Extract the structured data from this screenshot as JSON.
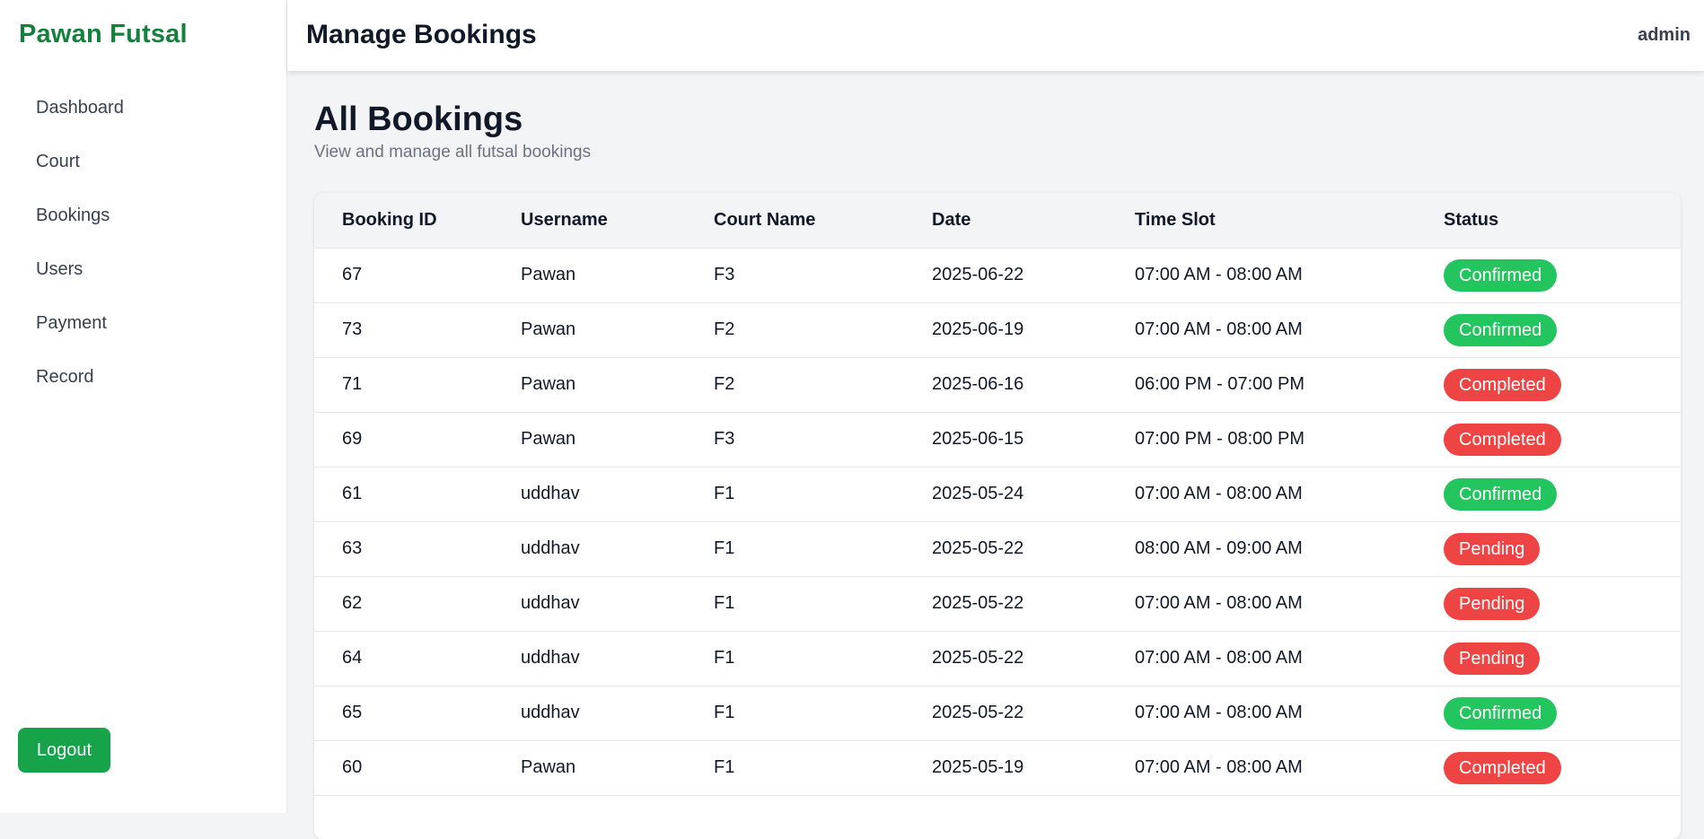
{
  "sidebar": {
    "brand": "Pawan Futsal",
    "items": [
      {
        "label": "Dashboard"
      },
      {
        "label": "Court"
      },
      {
        "label": "Bookings"
      },
      {
        "label": "Users"
      },
      {
        "label": "Payment"
      },
      {
        "label": "Record"
      }
    ],
    "logout_label": "Logout"
  },
  "topbar": {
    "title": "Manage Bookings",
    "user": "admin"
  },
  "main": {
    "title": "All Bookings",
    "subtitle": "View and manage all futsal bookings"
  },
  "table": {
    "headers": [
      "Booking ID",
      "Username",
      "Court Name",
      "Date",
      "Time Slot",
      "Status"
    ],
    "rows": [
      {
        "id": "67",
        "username": "Pawan",
        "court": "F3",
        "date": "2025-06-22",
        "slot": "07:00 AM - 08:00 AM",
        "status": "Confirmed"
      },
      {
        "id": "73",
        "username": "Pawan",
        "court": "F2",
        "date": "2025-06-19",
        "slot": "07:00 AM - 08:00 AM",
        "status": "Confirmed"
      },
      {
        "id": "71",
        "username": "Pawan",
        "court": "F2",
        "date": "2025-06-16",
        "slot": "06:00 PM - 07:00 PM",
        "status": "Completed"
      },
      {
        "id": "69",
        "username": "Pawan",
        "court": "F3",
        "date": "2025-06-15",
        "slot": "07:00 PM - 08:00 PM",
        "status": "Completed"
      },
      {
        "id": "61",
        "username": "uddhav",
        "court": "F1",
        "date": "2025-05-24",
        "slot": "07:00 AM - 08:00 AM",
        "status": "Confirmed"
      },
      {
        "id": "63",
        "username": "uddhav",
        "court": "F1",
        "date": "2025-05-22",
        "slot": "08:00 AM - 09:00 AM",
        "status": "Pending"
      },
      {
        "id": "62",
        "username": "uddhav",
        "court": "F1",
        "date": "2025-05-22",
        "slot": "07:00 AM - 08:00 AM",
        "status": "Pending"
      },
      {
        "id": "64",
        "username": "uddhav",
        "court": "F1",
        "date": "2025-05-22",
        "slot": "07:00 AM - 08:00 AM",
        "status": "Pending"
      },
      {
        "id": "65",
        "username": "uddhav",
        "court": "F1",
        "date": "2025-05-22",
        "slot": "07:00 AM - 08:00 AM",
        "status": "Confirmed"
      },
      {
        "id": "60",
        "username": "Pawan",
        "court": "F1",
        "date": "2025-05-19",
        "slot": "07:00 AM - 08:00 AM",
        "status": "Completed"
      }
    ]
  },
  "colors": {
    "brand": "#15803d",
    "logout": "#16a34a",
    "status_confirmed": "#22c55e",
    "status_completed": "#ef4444",
    "status_pending": "#ef4444"
  }
}
